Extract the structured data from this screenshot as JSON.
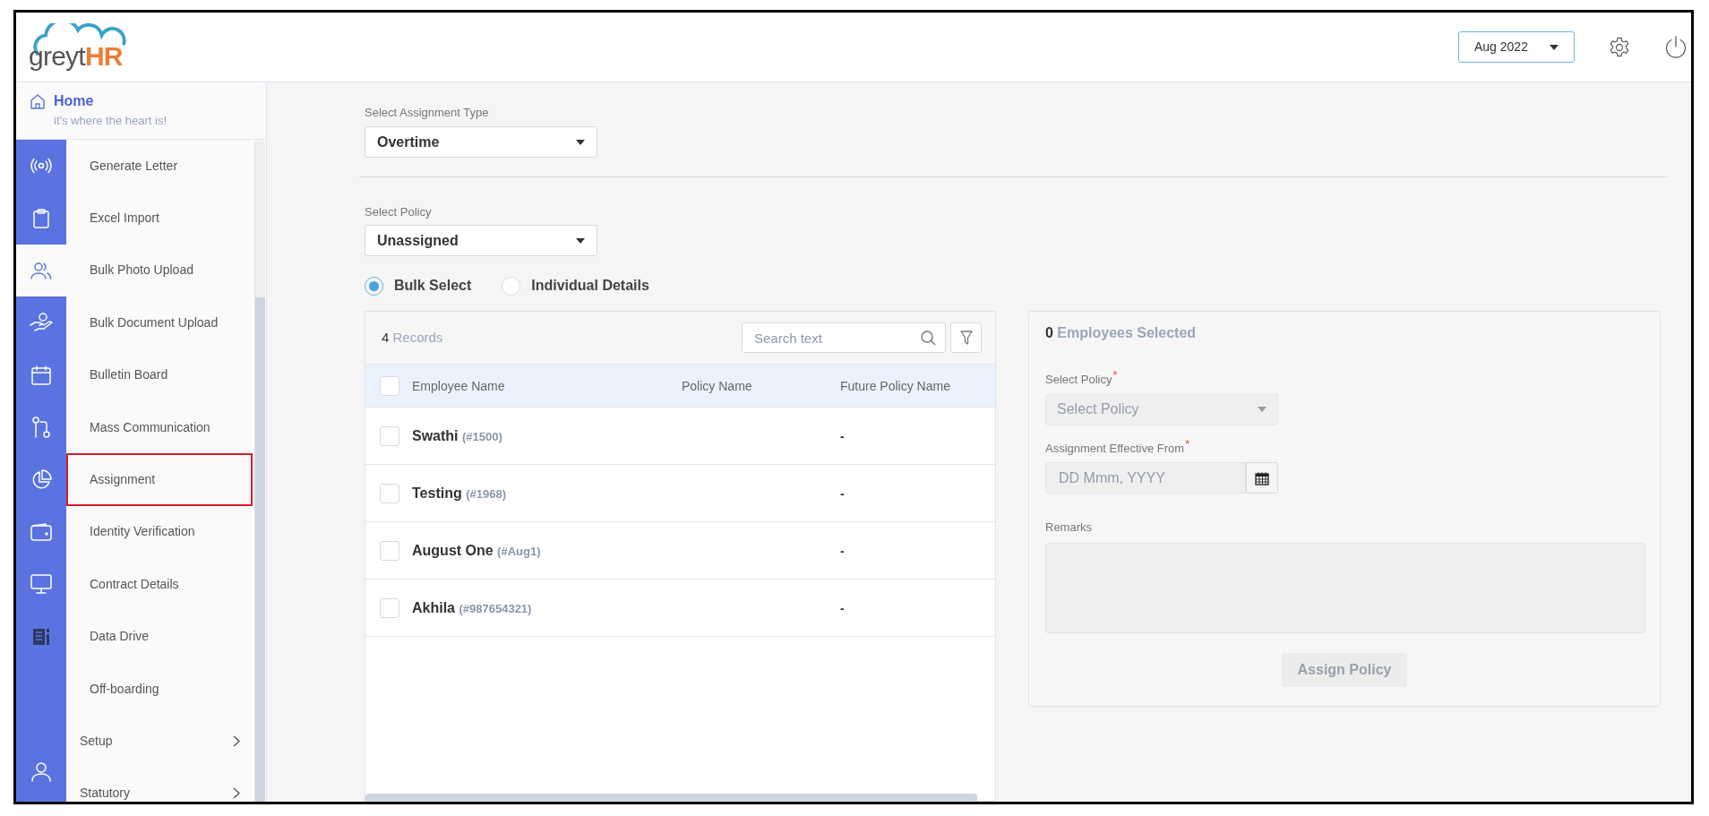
{
  "header": {
    "brand_prefix": "greyt",
    "brand_suffix": "HR",
    "month_picker": "Aug 2022"
  },
  "home": {
    "title": "Home",
    "subtitle": "it's where the heart is!"
  },
  "rail": [
    {
      "kind": "broadcast",
      "selected": false
    },
    {
      "kind": "clipboard",
      "selected": false
    },
    {
      "kind": "people",
      "selected": true
    },
    {
      "kind": "hand",
      "selected": false
    },
    {
      "kind": "calendar",
      "selected": false
    },
    {
      "kind": "flow",
      "selected": false
    },
    {
      "kind": "pie",
      "selected": false
    },
    {
      "kind": "wallet",
      "selected": false
    },
    {
      "kind": "monitor",
      "selected": false
    },
    {
      "kind": "document",
      "selected": false
    },
    {
      "kind": "user",
      "selected": false
    }
  ],
  "menu": [
    {
      "label": "Generate Letter",
      "kind": "link",
      "selected": false
    },
    {
      "label": "Excel Import",
      "kind": "link",
      "selected": false
    },
    {
      "label": "Bulk Photo Upload",
      "kind": "link",
      "selected": false
    },
    {
      "label": "Bulk Document Upload",
      "kind": "link",
      "selected": false
    },
    {
      "label": "Bulletin Board",
      "kind": "link",
      "selected": false
    },
    {
      "label": "Mass Communication",
      "kind": "link",
      "selected": false
    },
    {
      "label": "Assignment",
      "kind": "link",
      "selected": true
    },
    {
      "label": "Identity Verification",
      "kind": "link",
      "selected": false
    },
    {
      "label": "Contract Details",
      "kind": "link",
      "selected": false
    },
    {
      "label": "Data Drive",
      "kind": "link",
      "selected": false
    },
    {
      "label": "Off-boarding",
      "kind": "link",
      "selected": false
    },
    {
      "label": "Setup",
      "kind": "group",
      "expanded": false
    },
    {
      "label": "Statutory",
      "kind": "group",
      "expanded": false
    }
  ],
  "assignment_type": {
    "label": "Select Assignment Type",
    "value": "Overtime"
  },
  "policy_filter": {
    "label": "Select Policy",
    "value": "Unassigned"
  },
  "mode_options": [
    {
      "label": "Bulk Select",
      "selected": true
    },
    {
      "label": "Individual Details",
      "selected": false
    }
  ],
  "table": {
    "count": "4",
    "count_label": "Records",
    "search": {
      "placeholder": "Search text"
    },
    "columns": [
      "Employee Name",
      "Policy Name",
      "Future Policy Name"
    ],
    "all_checked": false,
    "rows": [
      {
        "name": "Swathi",
        "code": "(#1500)",
        "future_policy": "-",
        "checked": false
      },
      {
        "name": "Testing",
        "code": "(#1968)",
        "future_policy": "-",
        "checked": false
      },
      {
        "name": "August One",
        "code": "(#Aug1)",
        "future_policy": "-",
        "checked": false
      },
      {
        "name": "Akhila",
        "code": "(#987654321)",
        "future_policy": "-",
        "checked": false
      }
    ]
  },
  "assign_panel": {
    "count": "0",
    "count_label": "Employees Selected",
    "policy": {
      "label": "Select Policy",
      "required_mark": "*",
      "placeholder": "Select Policy",
      "disabled": true
    },
    "effective_from": {
      "label": "Assignment Effective From",
      "required_mark": "*",
      "placeholder": "DD Mmm, YYYY",
      "disabled": true
    },
    "remarks": {
      "label": "Remarks",
      "disabled": true
    },
    "button": {
      "label": "Assign Policy",
      "disabled": true
    }
  }
}
